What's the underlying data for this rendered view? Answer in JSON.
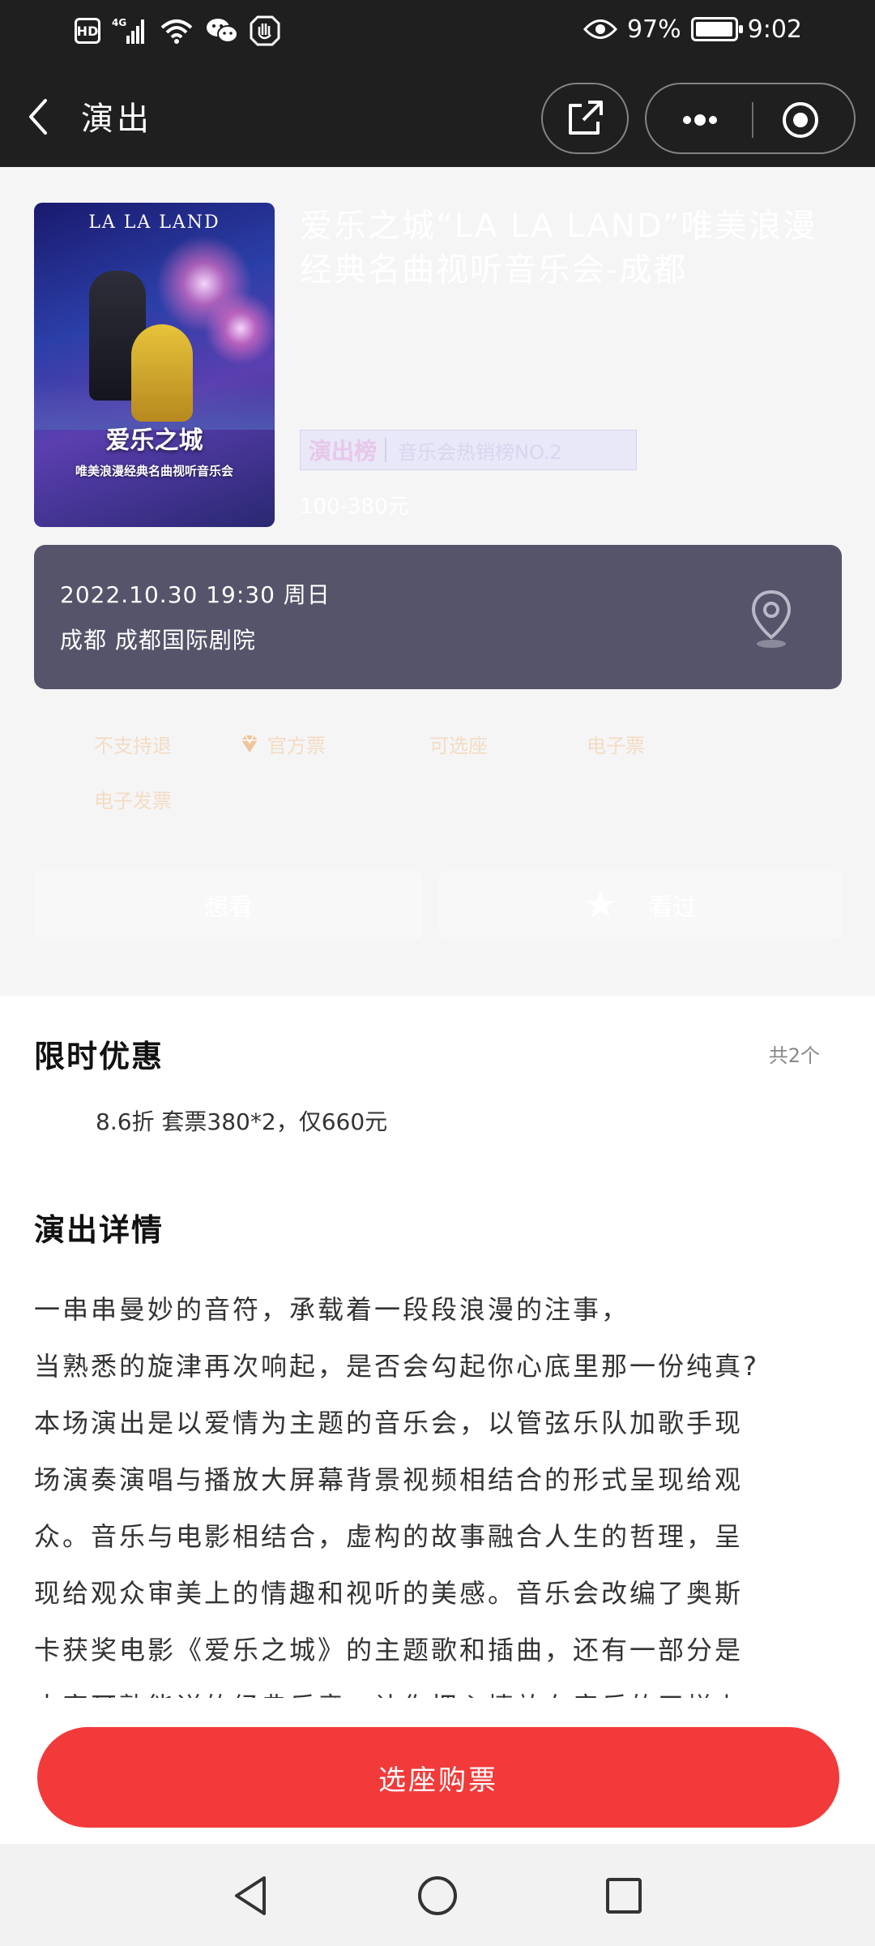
{
  "status_bar": {
    "hd_label": "HD",
    "network_label": "4G",
    "battery_percent": "97%",
    "battery_level": 0.97,
    "time": "9:02"
  },
  "nav": {
    "title": "演出"
  },
  "show": {
    "poster_top_text": "LA LA LAND",
    "poster_main_text": "爱乐之城",
    "poster_sub_text": "唯美浪漫经典名曲视听音乐会",
    "title": "爱乐之城“LA LA LAND”唯美浪漫经典名曲视听音乐会-成都",
    "rank_label": "演出榜",
    "rank_text": "音乐会热销榜NO.2",
    "price": "100-380元",
    "date": "2022.10.30  19:30  周日",
    "venue": "成都  成都国际剧院"
  },
  "tags": [
    {
      "label": "不支持退"
    },
    {
      "label": "官方票"
    },
    {
      "label": "可选座"
    },
    {
      "label": "电子票"
    },
    {
      "label": "电子发票"
    }
  ],
  "actions": {
    "want": "想看",
    "seen": "看过"
  },
  "promo": {
    "title": "限时优惠",
    "count": "共2个",
    "item": "8.6折  套票380*2，仅660元"
  },
  "detail": {
    "title": "演出详情",
    "lines": [
      "一串串曼妙的音符，承载着一段段浪漫的注事，",
      "当熟悉的旋津再次响起，是否会勾起你心底里那一份纯真?",
      "本场演出是以爱情为主题的音乐会，以管弦乐队加歌手现",
      "场演奏演唱与播放大屏幕背景视频相结合的形式呈现给观",
      "众。音乐与电影相结合，虚构的故事融合人生的哲理，呈",
      "现给观众审美上的情趣和视听的美感。音乐会改编了奥斯",
      "卡获奖电影《爱乐之城》的主题歌和插曲，还有一部分是",
      "大家耳熟能详的经典乐章，让你把心情放在音乐的天梯上"
    ]
  },
  "buy": {
    "label": "选座购票",
    "color": "#f23a3a"
  },
  "icons": {
    "back": "back-arrow-icon",
    "share": "share-icon",
    "more": "more-dots-icon",
    "close_mini": "target-circle-icon",
    "location": "location-pin-icon",
    "official": "diamond-icon",
    "star": "star-icon"
  }
}
